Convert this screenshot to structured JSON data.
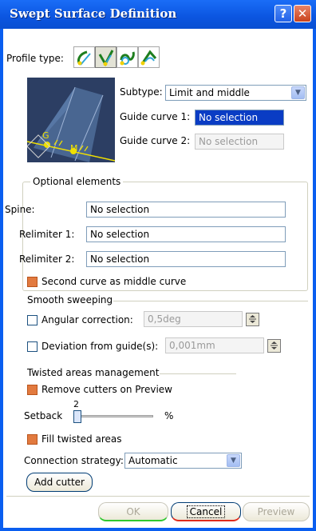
{
  "window": {
    "title": "Swept Surface Definition",
    "help": "?",
    "close": "✕"
  },
  "profile": {
    "label": "Profile type:",
    "buttons": [
      "profile-explicit-icon",
      "profile-line-icon",
      "profile-circle-icon",
      "profile-conic-icon"
    ],
    "selected_index": 1
  },
  "preview": {
    "g_label": "G",
    "m_label": "M"
  },
  "subtype": {
    "label": "Subtype:",
    "value": "Limit and middle"
  },
  "guide1": {
    "label": "Guide curve 1:",
    "value": "No selection"
  },
  "guide2": {
    "label": "Guide curve 2:",
    "value": "No selection"
  },
  "optional": {
    "title": "Optional elements",
    "spine": {
      "label": "Spine:",
      "value": "No selection"
    },
    "relimiter1": {
      "label": "Relimiter 1:",
      "value": "No selection"
    },
    "relimiter2": {
      "label": "Relimiter 2:",
      "value": "No selection"
    },
    "second_curve": {
      "label": "Second curve as middle curve",
      "checked": true
    }
  },
  "smooth": {
    "title": "Smooth sweeping",
    "angular": {
      "label": "Angular correction:",
      "value": "0,5deg",
      "checked": false
    },
    "deviation": {
      "label": "Deviation from guide(s):",
      "value": "0,001mm",
      "checked": false
    }
  },
  "twisted": {
    "title": "Twisted areas management",
    "remove_cutters": {
      "label": "Remove cutters on Preview",
      "checked": true
    },
    "setback": {
      "label": "Setback",
      "value": "2",
      "unit": "%",
      "level": 0.02
    },
    "fill_twisted": {
      "label": "Fill twisted areas",
      "checked": true
    }
  },
  "connection": {
    "label": "Connection strategy:",
    "value": "Automatic"
  },
  "add_cutter": {
    "label": "Add cutter"
  },
  "footer": {
    "ok": "OK",
    "cancel": "Cancel",
    "preview": "Preview"
  },
  "colors": {
    "titlebar": "#0b55e0",
    "preview_bg": "#2c3e63",
    "checked": "#e27a3f",
    "selection": "#0a3cc4"
  }
}
